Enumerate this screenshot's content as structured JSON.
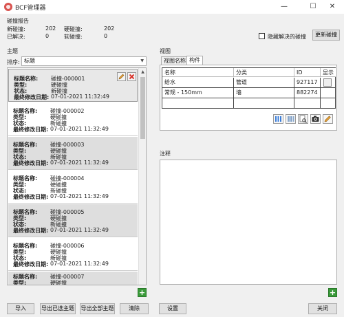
{
  "window": {
    "title": "BCF管理器",
    "minimize": "—",
    "maximize": "☐",
    "close": "✕"
  },
  "report": {
    "title": "碰撞报告",
    "new_label": "新碰撞:",
    "new_value": "202",
    "hard_label": "硬碰撞:",
    "hard_value": "202",
    "resolved_label": "已解决:",
    "resolved_value": "0",
    "soft_label": "软碰撞:",
    "soft_value": "0",
    "hide_resolved_label": "隐藏解决的碰撞",
    "refresh_button": "更新碰撞"
  },
  "topics": {
    "title": "主题",
    "sort_label": "排序:",
    "sort_value": "标题",
    "field_labels": {
      "title": "标题名称:",
      "type": "类型:",
      "status": "状态:",
      "modified": "最终修改日期:"
    },
    "items": [
      {
        "title": "碰撞-000001",
        "type": "硬碰撞",
        "status": "新碰撞",
        "modified": "07-01-2021 11:32:49"
      },
      {
        "title": "碰撞-000002",
        "type": "硬碰撞",
        "status": "新碰撞",
        "modified": "07-01-2021 11:32:49"
      },
      {
        "title": "碰撞-000003",
        "type": "硬碰撞",
        "status": "新碰撞",
        "modified": "07-01-2021 11:32:49"
      },
      {
        "title": "碰撞-000004",
        "type": "硬碰撞",
        "status": "新碰撞",
        "modified": "07-01-2021 11:32:49"
      },
      {
        "title": "碰撞-000005",
        "type": "硬碰撞",
        "status": "新碰撞",
        "modified": "07-01-2021 11:32:49"
      },
      {
        "title": "碰撞-000006",
        "type": "硬碰撞",
        "status": "新碰撞",
        "modified": "07-01-2021 11:32:49"
      },
      {
        "title": "碰撞-000007",
        "type": "硬碰撞",
        "status": "",
        "modified": ""
      }
    ]
  },
  "view": {
    "title": "视图",
    "tabs": [
      "视图名称",
      "构件"
    ],
    "columns": [
      "名称",
      "分类",
      "ID",
      "显示"
    ],
    "rows": [
      {
        "name": "给水",
        "category": "管道",
        "id": "927117"
      },
      {
        "name": "常规 - 150mm",
        "category": "墙",
        "id": "882274"
      }
    ]
  },
  "notes": {
    "title": "注释"
  },
  "footer": {
    "import": "导入",
    "export_selected": "导出已选主题",
    "export_all": "导出全部主题",
    "clear": "清除",
    "settings": "设置",
    "close": "关闭"
  },
  "icons": {
    "edit": "pencil-icon",
    "delete": "delete-icon",
    "add": "plus-icon",
    "colors": {
      "delete": "#d9342b",
      "add": "#3a9a3a",
      "app": "#d9534f"
    }
  }
}
